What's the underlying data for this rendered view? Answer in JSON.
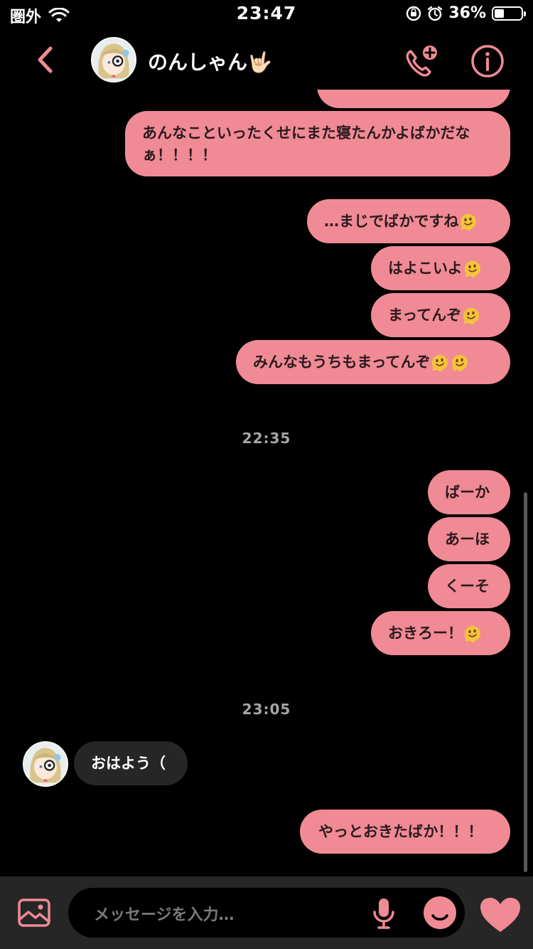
{
  "status_bar": {
    "carrier": "圏外",
    "time": "23:47",
    "battery": "36%",
    "battery_level": 0.36
  },
  "header": {
    "contact_name": "のんしゃん🤟🏻"
  },
  "messages": [
    {
      "id": "m0",
      "dir": "out",
      "text": ""
    },
    {
      "id": "m1",
      "dir": "out",
      "text": "あんなこといったくせにまた寝たんかよばかだなぁ！！！！"
    },
    {
      "id": "m2",
      "dir": "out",
      "text": "…まじでばかですね"
    },
    {
      "id": "m3",
      "dir": "out",
      "text": "はよこいよ"
    },
    {
      "id": "m4",
      "dir": "out",
      "text": "まってんぞ"
    },
    {
      "id": "m5",
      "dir": "out",
      "text": "みんなもうちもまってんぞ"
    },
    {
      "id": "m6",
      "dir": "out",
      "text": "ばーか"
    },
    {
      "id": "m7",
      "dir": "out",
      "text": "あーほ"
    },
    {
      "id": "m8",
      "dir": "out",
      "text": "くーそ"
    },
    {
      "id": "m9",
      "dir": "out",
      "text": "おきろー！"
    },
    {
      "id": "m10",
      "dir": "in",
      "text": "おはよう（"
    },
    {
      "id": "m11",
      "dir": "out",
      "text": "やっとおきたばか！！！"
    }
  ],
  "timestamps": [
    "22:35",
    "23:05"
  ],
  "composer": {
    "placeholder": "メッセージを入力…"
  },
  "colors": {
    "accent": "#f08a94",
    "bubble_text": "#2b1a1d",
    "received_bubble": "#262626",
    "background": "#000000"
  },
  "icons": [
    "back-icon",
    "video-call-icon",
    "info-icon",
    "gallery-icon",
    "microphone-icon",
    "emoji-icon",
    "heart-icon",
    "melting-face-emoji"
  ]
}
